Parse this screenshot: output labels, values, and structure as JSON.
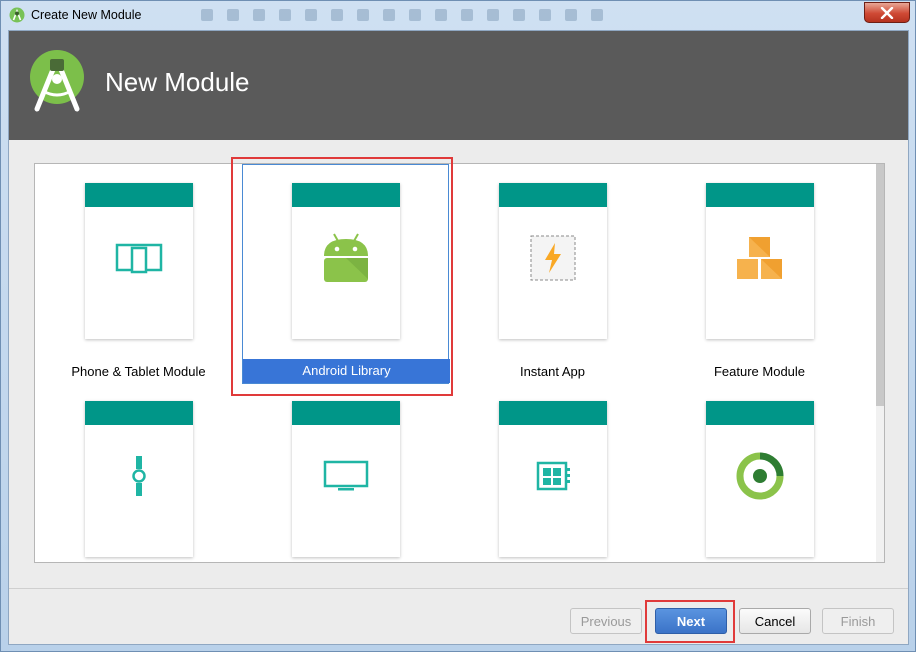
{
  "window": {
    "title": "Create New Module",
    "close_icon": "close-icon"
  },
  "header": {
    "title": "New Module",
    "logo_icon": "android-studio-logo"
  },
  "gallery": {
    "tiles": [
      {
        "label": "Phone & Tablet Module",
        "icon": "phone-tablet-icon",
        "selected": false
      },
      {
        "label": "Android Library",
        "icon": "android-robot-icon",
        "selected": true
      },
      {
        "label": "Instant App",
        "icon": "instant-app-icon",
        "selected": false
      },
      {
        "label": "Feature Module",
        "icon": "feature-module-icon",
        "selected": false
      },
      {
        "label": "",
        "icon": "wear-watch-icon",
        "selected": false
      },
      {
        "label": "",
        "icon": "tv-icon",
        "selected": false
      },
      {
        "label": "",
        "icon": "things-board-icon",
        "selected": false
      },
      {
        "label": "",
        "icon": "ci-ring-icon",
        "selected": false
      }
    ]
  },
  "buttons": {
    "previous": "Previous",
    "next": "Next",
    "cancel": "Cancel",
    "finish": "Finish"
  },
  "colors": {
    "header_bg": "#5a5a5a",
    "card_accent": "#009688",
    "selection": "#3875d7",
    "highlight_box": "#e03a3a"
  }
}
